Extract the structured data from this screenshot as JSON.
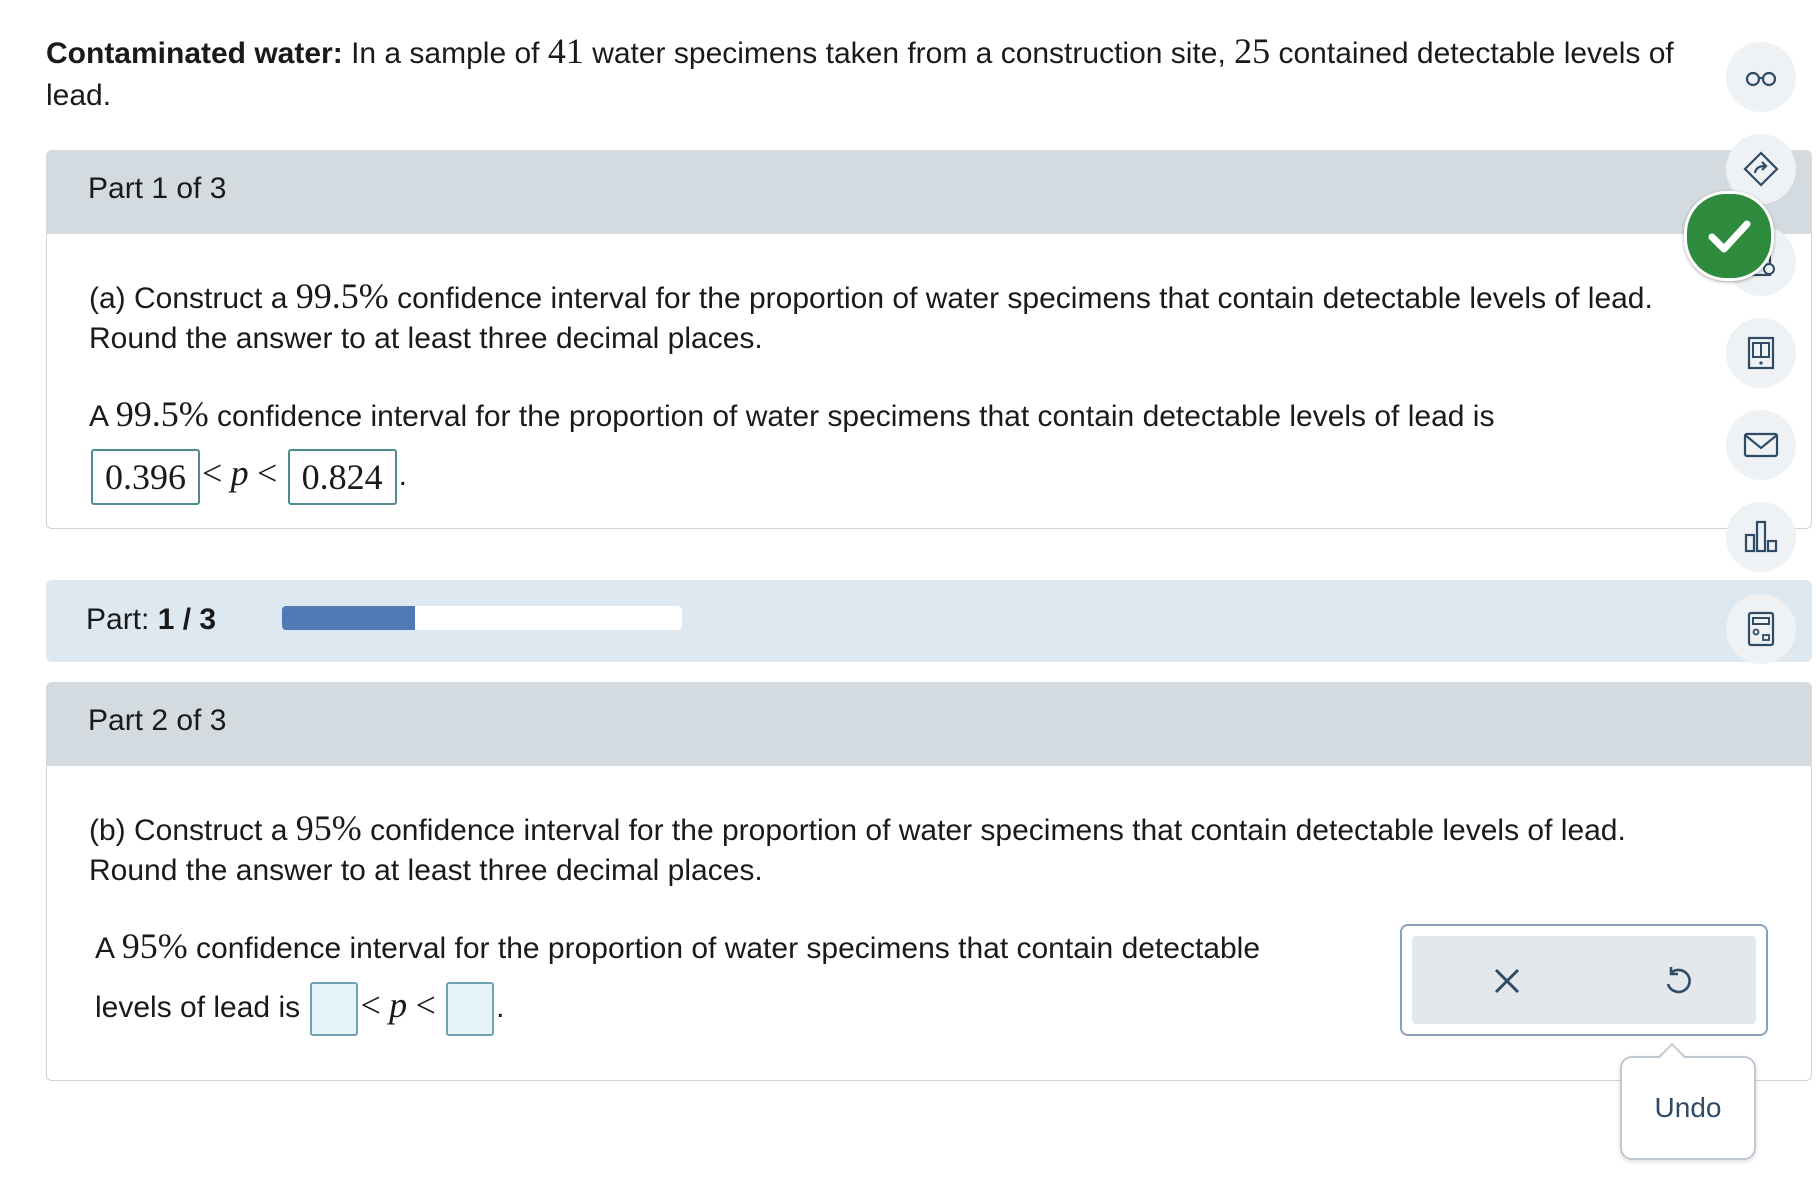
{
  "problem": {
    "title": "Contaminated water:",
    "text_a": "In a sample of",
    "n": "41",
    "text_b": "water specimens taken from a construction site,",
    "x": "25",
    "text_c": "contained detectable levels of lead."
  },
  "part1": {
    "header": "Part 1 of 3",
    "question_prefix": "(a) Construct a",
    "confidence": "99.5%",
    "question_suffix": "confidence interval for the proportion of water specimens that contain detectable levels of lead.",
    "round_text": "Round the answer to at least three decimal places.",
    "answer_prefix": "A",
    "answer_text": "confidence interval for the proportion of water specimens that contain detectable levels of lead is",
    "lower": "0.396",
    "upper": "0.824",
    "lt": "<",
    "p": "p",
    "period": "."
  },
  "progress": {
    "label": "Part:",
    "value": "1 / 3",
    "fraction": 0.333
  },
  "part2": {
    "header": "Part 2 of 3",
    "question_prefix": "(b) Construct a",
    "confidence": "95%",
    "question_suffix": "confidence interval for the proportion of water specimens that contain detectable levels of lead.",
    "round_text": "Round the answer to at least three decimal places.",
    "answer_prefix": "A",
    "answer_text_1": "confidence interval for the proportion of water specimens that contain detectable",
    "answer_text_2": "levels of lead is",
    "lower": "",
    "upper": "",
    "lt": "<",
    "p": "p",
    "period": "."
  },
  "tooltip": {
    "undo_label": "Undo"
  },
  "sidebar": {
    "icons": [
      "glasses-icon",
      "share-icon",
      "lesson-icon",
      "ebook-icon",
      "message-icon",
      "stats-icon",
      "calculator-icon"
    ]
  },
  "colors": {
    "accent_green": "#2e8b3e",
    "progress_fill": "#4f7bb5",
    "header_gray": "#d3dbe0"
  }
}
